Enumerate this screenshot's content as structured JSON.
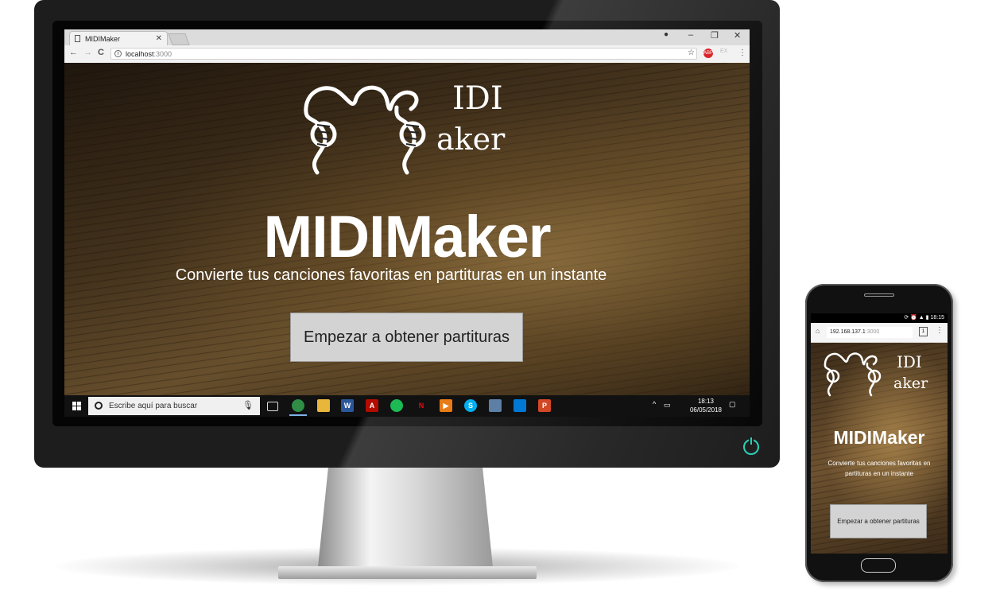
{
  "desktop": {
    "browser": {
      "tab_title": "MIDIMaker",
      "tab_close": "✕",
      "url_host": "localhost",
      "url_port": ":3000",
      "window_controls": [
        "–",
        "❐",
        "✕"
      ],
      "nav": {
        "back": "←",
        "forward": "→",
        "reload": "C"
      }
    },
    "page": {
      "logo_line1": "IDI",
      "logo_line2": "aker",
      "title": "MIDIMaker",
      "subtitle": "Convierte tus canciones favoritas en partituras en un instante",
      "cta_label": "Empezar a obtener partituras"
    },
    "taskbar": {
      "search_placeholder": "Escribe aquí para buscar",
      "time": "18:13",
      "date": "06/05/2018",
      "icons": [
        "task-view",
        "chrome",
        "file-explorer",
        "word",
        "acrobat",
        "spotify",
        "netflix",
        "media-player",
        "skype",
        "virtualbox",
        "vscode",
        "powerpoint"
      ]
    }
  },
  "phone": {
    "status_time": "18:15",
    "url_host": "192.168.137.1",
    "url_port": ":3000",
    "page": {
      "logo_line1": "IDI",
      "logo_line2": "aker",
      "title": "MIDIMaker",
      "subtitle": "Convierte tus canciones favoritas en partituras en un instante",
      "cta_label": "Empezar a obtener partituras"
    }
  },
  "colors": {
    "accent_power": "#2ad1b5",
    "button_bg": "#d3d3d3"
  }
}
